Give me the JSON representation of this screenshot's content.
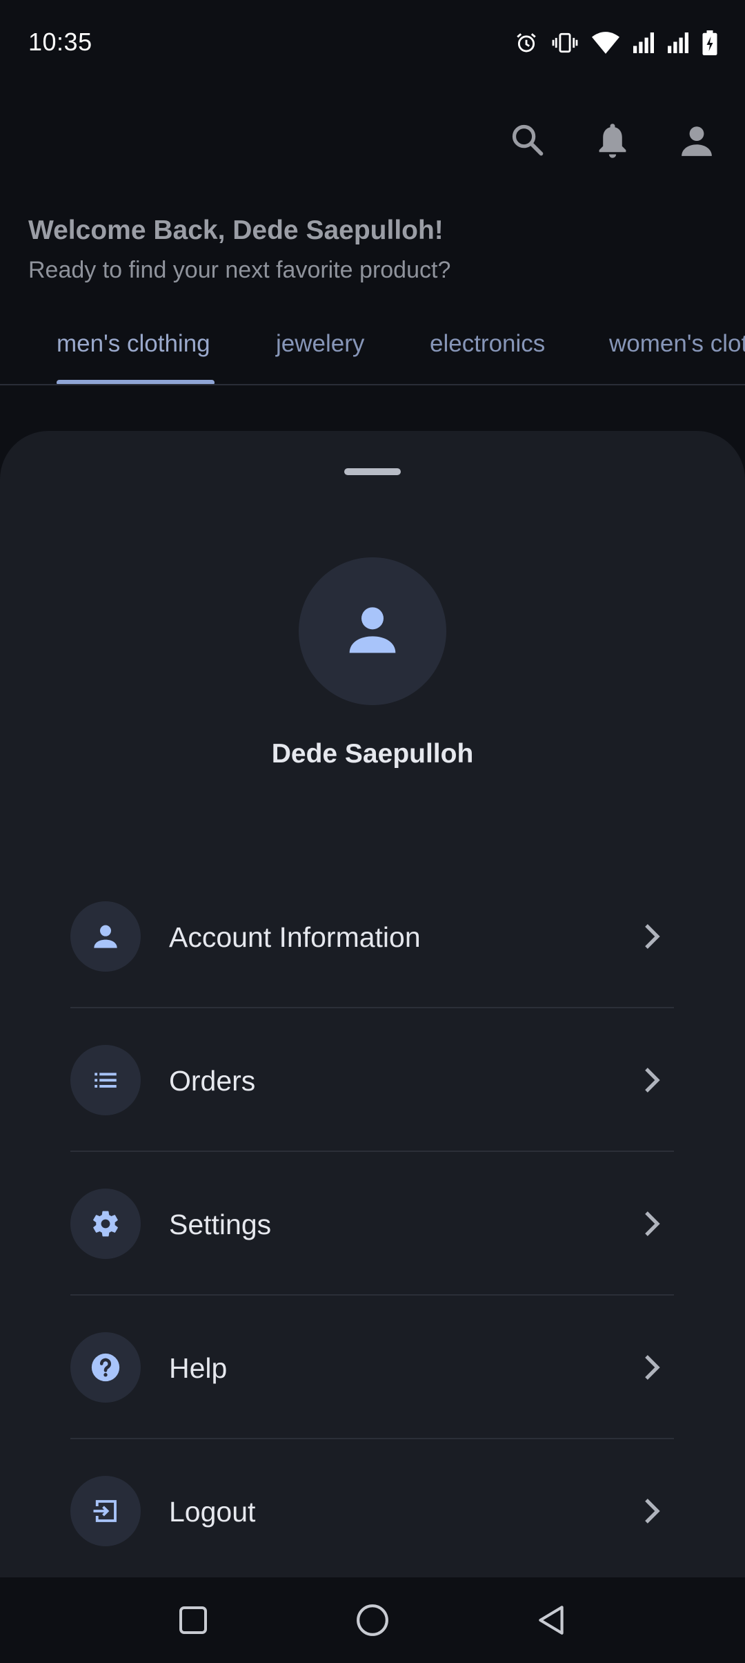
{
  "status_bar": {
    "time": "10:35",
    "icons": [
      "alarm-icon",
      "vibrate-icon",
      "wifi-icon",
      "signal-icon",
      "signal-icon",
      "battery-charging-icon"
    ]
  },
  "app_bar": {
    "actions": [
      "search-icon",
      "bell-icon",
      "person-icon"
    ]
  },
  "welcome": {
    "title": "Welcome Back, Dede Saepulloh!",
    "subtitle": "Ready to find your next favorite product?"
  },
  "tabs": [
    {
      "label": "men's clothing",
      "active": true
    },
    {
      "label": "jewelery",
      "active": false
    },
    {
      "label": "electronics",
      "active": false
    },
    {
      "label": "women's clothing",
      "active": false
    }
  ],
  "profile": {
    "name": "Dede Saepulloh",
    "avatar_icon": "person-icon"
  },
  "menu": [
    {
      "label": "Account Information",
      "icon": "person-icon"
    },
    {
      "label": "Orders",
      "icon": "list-icon"
    },
    {
      "label": "Settings",
      "icon": "gear-icon"
    },
    {
      "label": "Help",
      "icon": "help-circle-icon"
    },
    {
      "label": "Logout",
      "icon": "logout-icon"
    }
  ],
  "nav_bar": {
    "buttons": [
      "recents-square-icon",
      "home-circle-icon",
      "back-triangle-icon"
    ]
  },
  "colors": {
    "background": "#0d0f14",
    "sheet": "#1a1d24",
    "accent": "#a8c4fa",
    "tab_text": "#8796b8"
  }
}
